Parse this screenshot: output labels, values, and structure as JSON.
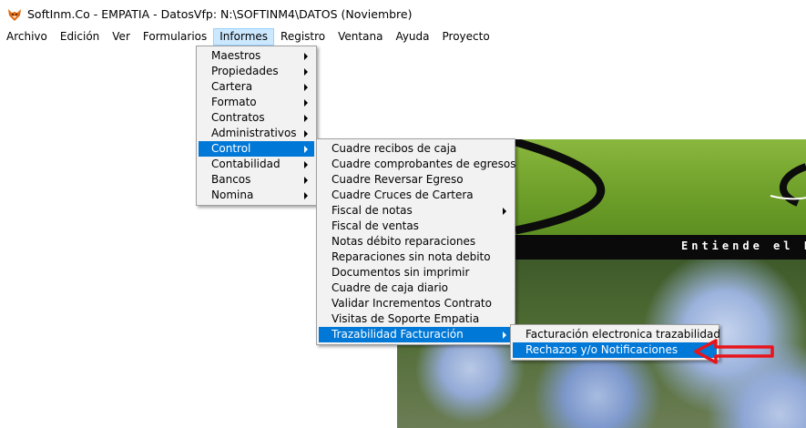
{
  "window": {
    "title": "SoftInm.Co - EMPATIA - DatosVfp: N:\\SOFTINM4\\DATOS  (Noviembre)",
    "icon": "fox-icon"
  },
  "menubar": {
    "items": [
      "Archivo",
      "Edición",
      "Ver",
      "Formularios",
      "Informes",
      "Registro",
      "Ventana",
      "Ayuda",
      "Proyecto"
    ],
    "active": "Informes"
  },
  "informes_menu": {
    "items": [
      {
        "label": "Maestros",
        "submenu": true
      },
      {
        "label": "Propiedades",
        "submenu": true
      },
      {
        "label": "Cartera",
        "submenu": true
      },
      {
        "label": "Formato",
        "submenu": true
      },
      {
        "label": "Contratos",
        "submenu": true
      },
      {
        "label": "Administrativos",
        "submenu": true
      },
      {
        "label": "Control",
        "submenu": true,
        "selected": true
      },
      {
        "label": "Contabilidad",
        "submenu": true
      },
      {
        "label": "Bancos",
        "submenu": true
      },
      {
        "label": "Nomina",
        "submenu": true
      }
    ]
  },
  "control_menu": {
    "items": [
      {
        "label": "Cuadre recibos de caja",
        "submenu": false
      },
      {
        "label": "Cuadre comprobantes de egresos",
        "submenu": false
      },
      {
        "label": "Cuadre Reversar Egreso",
        "submenu": false
      },
      {
        "label": "Cuadre Cruces de Cartera",
        "submenu": false
      },
      {
        "label": "Fiscal de notas",
        "submenu": true
      },
      {
        "label": "Fiscal de ventas",
        "submenu": false
      },
      {
        "label": "Notas débito reparaciones",
        "submenu": false
      },
      {
        "label": "Reparaciones sin nota debito",
        "submenu": false
      },
      {
        "label": "Documentos sin imprimir",
        "submenu": false
      },
      {
        "label": "Cuadre de caja diario",
        "submenu": false
      },
      {
        "label": "Validar Incrementos Contrato",
        "submenu": false
      },
      {
        "label": "Visitas de Soporte Empatia",
        "submenu": false
      },
      {
        "label": "Trazabilidad Facturación",
        "submenu": true,
        "selected": true
      }
    ]
  },
  "trazabilidad_menu": {
    "items": [
      {
        "label": "Facturación electronica trazabilidad",
        "submenu": false
      },
      {
        "label": "Rechazos y/o Notificaciones",
        "submenu": false,
        "selected": true
      }
    ]
  },
  "banner": {
    "tagline": "Entiende el Es"
  },
  "colors": {
    "selection": "#0078d7",
    "menu_background": "#f2f2f2",
    "menubar_active": "#cce8ff",
    "annotation_arrow": "#e8141c",
    "banner_green": "#6fa02a"
  }
}
